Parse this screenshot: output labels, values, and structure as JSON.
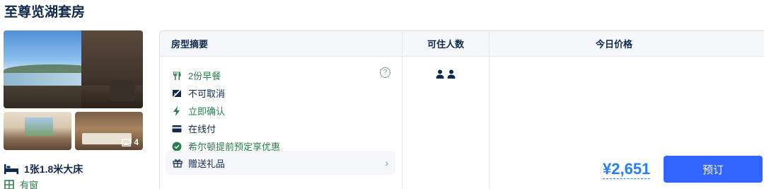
{
  "room": {
    "title": "至尊览湖套房",
    "photo_count": "4",
    "bed": "1张1.8米大床",
    "window": "有窗"
  },
  "table": {
    "headers": {
      "summary": "房型摘要",
      "occupancy": "可住人数",
      "price": "今日价格"
    },
    "features": [
      {
        "icon": "fork-knife-icon",
        "label": "2份早餐",
        "color": "green"
      },
      {
        "icon": "no-cancel-icon",
        "label": "不可取消",
        "color": "default"
      },
      {
        "icon": "lightning-icon",
        "label": "立即确认",
        "color": "green"
      },
      {
        "icon": "card-icon",
        "label": "在线付",
        "color": "default"
      },
      {
        "icon": "check-circle-icon",
        "label": "希尔顿提前预定享优惠",
        "color": "green"
      }
    ],
    "help": "?",
    "gift": {
      "label": "赠送礼品"
    },
    "occupancy": {
      "count": 2
    },
    "price": "¥2,651",
    "book_label": "预订"
  },
  "colors": {
    "green": "#287e4a",
    "blue": "#287dfa",
    "button": "#3264ff",
    "text": "#0f294d"
  }
}
